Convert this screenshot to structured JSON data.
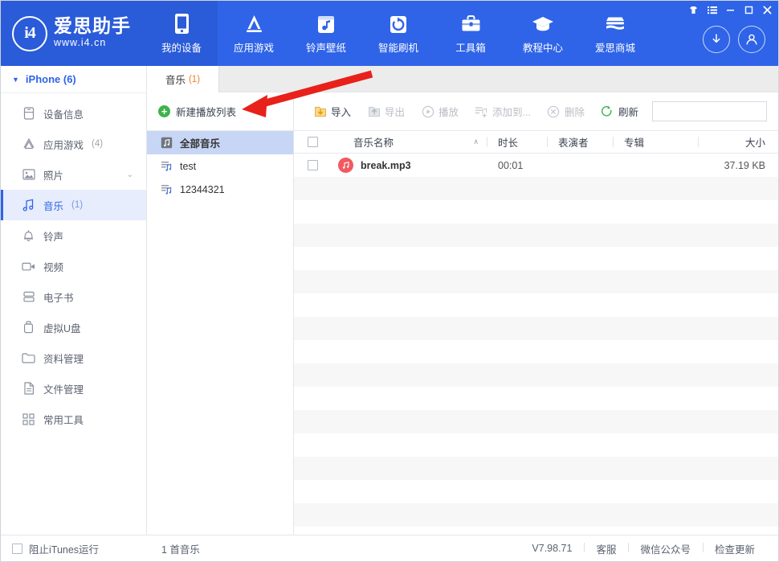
{
  "app": {
    "brand_initials": "i4",
    "brand_name": "爱思助手",
    "brand_url": "www.i4.cn"
  },
  "topnav": {
    "items": [
      {
        "label": "我的设备",
        "icon": "phone-icon",
        "active": true
      },
      {
        "label": "应用游戏",
        "icon": "appstore-icon",
        "active": false
      },
      {
        "label": "铃声壁纸",
        "icon": "ringtone-icon",
        "active": false
      },
      {
        "label": "智能刷机",
        "icon": "flash-icon",
        "active": false
      },
      {
        "label": "工具箱",
        "icon": "toolbox-icon",
        "active": false
      },
      {
        "label": "教程中心",
        "icon": "graduation-icon",
        "active": false
      },
      {
        "label": "爱思商城",
        "icon": "store-icon",
        "active": false
      }
    ],
    "download_icon": "download-icon",
    "account_icon": "account-icon"
  },
  "window_controls": {
    "skin": "skin-icon",
    "menu": "menu-icon",
    "minimize": "minimize-icon",
    "maximize": "maximize-icon",
    "close": "close-icon"
  },
  "sidebar": {
    "device": {
      "label": "iPhone (6)",
      "caret": "▼"
    },
    "items": [
      {
        "label": "设备信息",
        "icon": "device-info-icon",
        "count": "",
        "chevron": "",
        "active": false
      },
      {
        "label": "应用游戏",
        "icon": "apps-icon",
        "count": "(4)",
        "chevron": "",
        "active": false
      },
      {
        "label": "照片",
        "icon": "photo-icon",
        "count": "",
        "chevron": "⌄",
        "active": false
      },
      {
        "label": "音乐",
        "icon": "music-icon",
        "count": "(1)",
        "chevron": "",
        "active": true
      },
      {
        "label": "铃声",
        "icon": "bell-icon",
        "count": "",
        "chevron": "",
        "active": false
      },
      {
        "label": "视频",
        "icon": "video-icon",
        "count": "",
        "chevron": "",
        "active": false
      },
      {
        "label": "电子书",
        "icon": "ebook-icon",
        "count": "",
        "chevron": "",
        "active": false
      },
      {
        "label": "虚拟U盘",
        "icon": "usb-icon",
        "count": "",
        "chevron": "",
        "active": false
      },
      {
        "label": "资料管理",
        "icon": "folder-icon",
        "count": "",
        "chevron": "",
        "active": false
      },
      {
        "label": "文件管理",
        "icon": "file-icon",
        "count": "",
        "chevron": "",
        "active": false
      },
      {
        "label": "常用工具",
        "icon": "grid-icon",
        "count": "",
        "chevron": "",
        "active": false
      }
    ]
  },
  "tab": {
    "label": "音乐",
    "count": "(1)"
  },
  "playlist_panel": {
    "new_playlist_label": "新建播放列表",
    "items": [
      {
        "label": "全部音乐",
        "icon": "all-music-icon",
        "active": true
      },
      {
        "label": "test",
        "icon": "playlist-icon",
        "active": false
      },
      {
        "label": "12344321",
        "icon": "playlist-icon",
        "active": false
      }
    ]
  },
  "toolbar": {
    "buttons": [
      {
        "label": "导入",
        "icon": "import-icon",
        "disabled": false
      },
      {
        "label": "导出",
        "icon": "export-icon",
        "disabled": true
      },
      {
        "label": "播放",
        "icon": "play-icon",
        "disabled": true
      },
      {
        "label": "添加到...",
        "icon": "add-to-icon",
        "disabled": true
      },
      {
        "label": "删除",
        "icon": "delete-icon",
        "disabled": true
      },
      {
        "label": "刷新",
        "icon": "refresh-icon",
        "disabled": false
      }
    ],
    "search": {
      "value": "",
      "placeholder": "",
      "icon": "search-icon"
    }
  },
  "table": {
    "columns": {
      "name": "音乐名称",
      "duration": "时长",
      "artist": "表演者",
      "album": "专辑",
      "size": "大小"
    },
    "sort_indicator": "∧",
    "rows": [
      {
        "name": "break.mp3",
        "duration": "00:01",
        "artist": "",
        "album": "",
        "size": "37.19 KB",
        "icon": "music-note-icon"
      }
    ],
    "empty_rows": 16
  },
  "statusbar": {
    "block_itunes_label": "阻止iTunes运行",
    "count_label": "1 首音乐",
    "version": "V7.98.71",
    "links": [
      "客服",
      "微信公众号",
      "检查更新"
    ]
  },
  "annotation": {
    "arrow_color": "#e8211a"
  }
}
